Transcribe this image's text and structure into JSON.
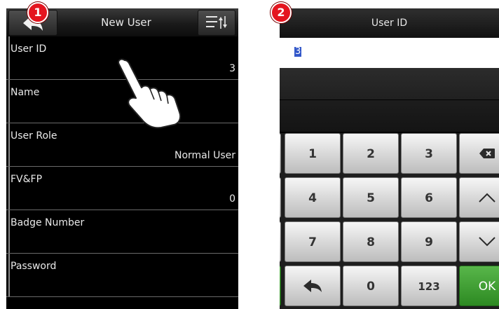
{
  "badges": {
    "panel1": "1",
    "panel2": "2"
  },
  "panel1": {
    "title": "New User",
    "fields": [
      {
        "label": "User ID",
        "value": "3"
      },
      {
        "label": "Name",
        "value": ""
      },
      {
        "label": "User Role",
        "value": "Normal User"
      },
      {
        "label": "FV&FP",
        "value": "0"
      },
      {
        "label": "Badge Number",
        "value": ""
      },
      {
        "label": "Password",
        "value": ""
      }
    ],
    "icons": {
      "back": "back-arrow-icon",
      "menu": "sort-menu-icon",
      "hand": "pointing-hand-icon"
    }
  },
  "panel2": {
    "title": "User ID",
    "input_value": "3",
    "keys": {
      "k1": "1",
      "k2": "2",
      "k3": "3",
      "k4": "4",
      "k5": "5",
      "k6": "6",
      "k7": "7",
      "k8": "8",
      "k9": "9",
      "k0": "0",
      "mode": "123",
      "ok": "OK"
    },
    "icons": {
      "backspace": "backspace-icon",
      "up": "chevron-up-icon",
      "down": "chevron-down-icon",
      "back": "return-arrow-icon"
    }
  },
  "colors": {
    "badge": "#e4151f",
    "ok_key": "#3a9a2e",
    "selection": "#3257c9"
  }
}
